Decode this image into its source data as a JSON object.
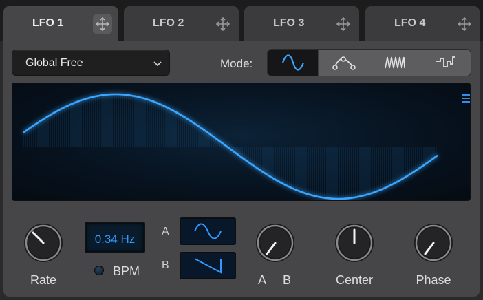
{
  "tabs": [
    {
      "label": "LFO 1",
      "active": true,
      "icon": "move-icon"
    },
    {
      "label": "LFO 2",
      "active": false,
      "icon": "move-icon"
    },
    {
      "label": "LFO 3",
      "active": false,
      "icon": "move-icon"
    },
    {
      "label": "LFO 4",
      "active": false,
      "icon": "move-icon"
    }
  ],
  "sync": {
    "selected": "Global Free",
    "icon": "chevron-down-icon"
  },
  "mode": {
    "label": "Mode:",
    "options": [
      "sine-wave-icon",
      "curve-nodes-icon",
      "sawtooth-icon",
      "step-icon"
    ],
    "selected_index": 0
  },
  "display": {
    "menu_icon": "hamburger-menu-icon",
    "waveform": "sine"
  },
  "controls": {
    "rate_label": "Rate",
    "rate_value": "0.34 Hz",
    "bpm_label": "BPM",
    "wave_a_letter": "A",
    "wave_b_letter": "B",
    "wave_a_shape": "sine",
    "wave_b_shape": "sawtooth",
    "ab_label_a": "A",
    "ab_label_b": "B",
    "center_label": "Center",
    "phase_label": "Phase"
  },
  "colors": {
    "accent": "#2f9bff",
    "waveform": "#3aa6ff"
  }
}
